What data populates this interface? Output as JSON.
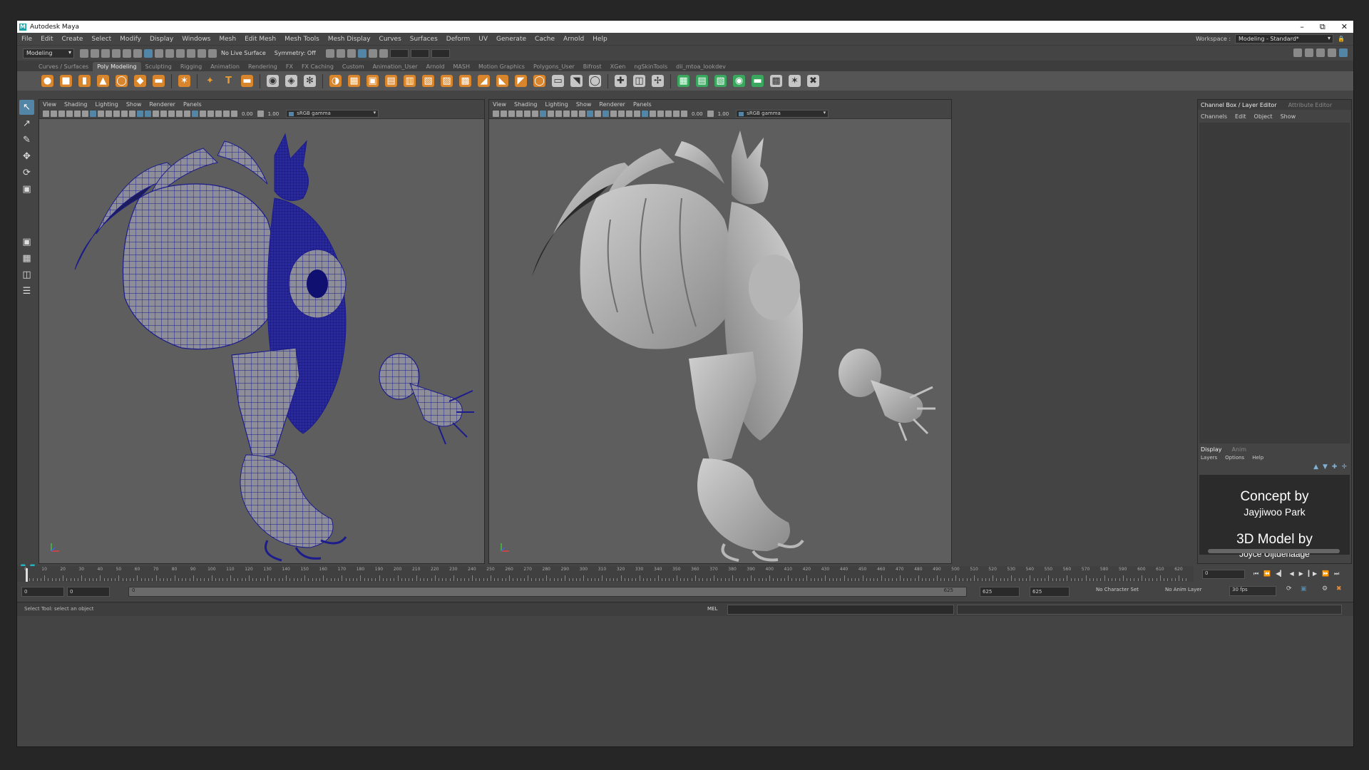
{
  "window": {
    "title": "Autodesk Maya",
    "controls": [
      "–",
      "⧉",
      "✕"
    ]
  },
  "menubar": [
    "File",
    "Edit",
    "Create",
    "Select",
    "Modify",
    "Display",
    "Windows",
    "Mesh",
    "Edit Mesh",
    "Mesh Tools",
    "Mesh Display",
    "Curves",
    "Surfaces",
    "Deform",
    "UV",
    "Generate",
    "Cache",
    "Arnold",
    "Help"
  ],
  "workspace": {
    "label": "Workspace :",
    "value": "Modeling - Standard*"
  },
  "statusline": {
    "mode": "Modeling",
    "live_surface": "No Live Surface",
    "symmetry": "Symmetry: Off"
  },
  "shelf_tabs": [
    "Curves / Surfaces",
    "Poly Modeling",
    "Sculpting",
    "Rigging",
    "Animation",
    "Rendering",
    "FX",
    "FX Caching",
    "Custom",
    "Animation_User",
    "Arnold",
    "MASH",
    "Motion Graphics",
    "Polygons_User",
    "Bifrost",
    "XGen",
    "ngSkinTools",
    "dii_mtoa_lookdev"
  ],
  "shelf_active": "Poly Modeling",
  "viewport_menu": [
    "View",
    "Shading",
    "Lighting",
    "Show",
    "Renderer",
    "Panels"
  ],
  "viewport_tools": {
    "exposure": "0.00",
    "gamma": "1.00",
    "colorspace": "sRGB gamma"
  },
  "channel_box": {
    "tabs": [
      "Channel Box / Layer Editor",
      "Attribute Editor"
    ],
    "menu": [
      "Channels",
      "Edit",
      "Object",
      "Show"
    ]
  },
  "layer_editor": {
    "tabs": [
      "Display",
      "Anim"
    ],
    "menu": [
      "Layers",
      "Options",
      "Help"
    ]
  },
  "credits": {
    "concept_by": "Concept by",
    "concept_artist": "Jayjiwoo Park",
    "model_by": "3D Model by",
    "model_artist": "Joyce Uijtdehaage"
  },
  "timeline": {
    "ticks": [
      "0",
      "10",
      "20",
      "30",
      "40",
      "50",
      "60",
      "70",
      "80",
      "90",
      "100",
      "110",
      "120",
      "130",
      "140",
      "150",
      "160",
      "170",
      "180",
      "190",
      "200",
      "210",
      "220",
      "230",
      "240",
      "250",
      "260",
      "270",
      "280",
      "290",
      "300",
      "310",
      "320",
      "330",
      "340",
      "350",
      "360",
      "370",
      "380",
      "390",
      "400",
      "410",
      "420",
      "430",
      "440",
      "450",
      "460",
      "470",
      "480",
      "490",
      "500",
      "510",
      "520",
      "530",
      "540",
      "550",
      "560",
      "570",
      "580",
      "590",
      "600",
      "610",
      "620"
    ],
    "current_frame": "0"
  },
  "range": {
    "start": "0",
    "anim_start": "0",
    "bar_start": "0",
    "bar_end": "625",
    "end": "625",
    "anim_end": "625",
    "character_set": "No Character Set",
    "anim_layer": "No Anim Layer",
    "fps": "30 fps"
  },
  "cmdline": {
    "help": "Select Tool: select an object",
    "lang": "MEL"
  },
  "colors": {
    "accent": "#5285a6",
    "wireframe": "#1c1c8c",
    "viewport_bg": "#5e5e5e",
    "maya_logo": "#21b2c4"
  }
}
